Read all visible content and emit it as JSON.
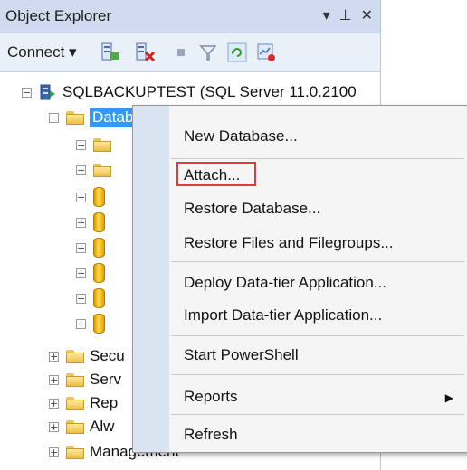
{
  "window": {
    "title": "Object Explorer",
    "controls": [
      "▾",
      "⊥",
      "✕"
    ]
  },
  "toolbar": {
    "connect_label": "Connect ▾",
    "icons": [
      "connect-server-icon",
      "disconnect-icon",
      "stop-icon",
      "filter-icon",
      "refresh-icon",
      "activity-monitor-icon"
    ]
  },
  "tree": {
    "server_label": "SQLBACKUPTEST (SQL Server 11.0.2100",
    "selected_label": "Datab",
    "items": [
      {
        "label": "Secu"
      },
      {
        "label": "Serv"
      },
      {
        "label": "Rep"
      },
      {
        "label": "Alw"
      },
      {
        "label": "Management"
      }
    ]
  },
  "context_menu": {
    "items": [
      {
        "label": "New Database..."
      },
      {
        "label": "Attach..."
      },
      {
        "label": "Restore Database..."
      },
      {
        "label": "Restore Files and Filegroups..."
      },
      {
        "label": "Deploy Data-tier Application..."
      },
      {
        "label": "Import Data-tier Application..."
      },
      {
        "label": "Start PowerShell"
      },
      {
        "label": "Reports",
        "submenu_glyph": "▶"
      },
      {
        "label": "Refresh"
      }
    ]
  }
}
